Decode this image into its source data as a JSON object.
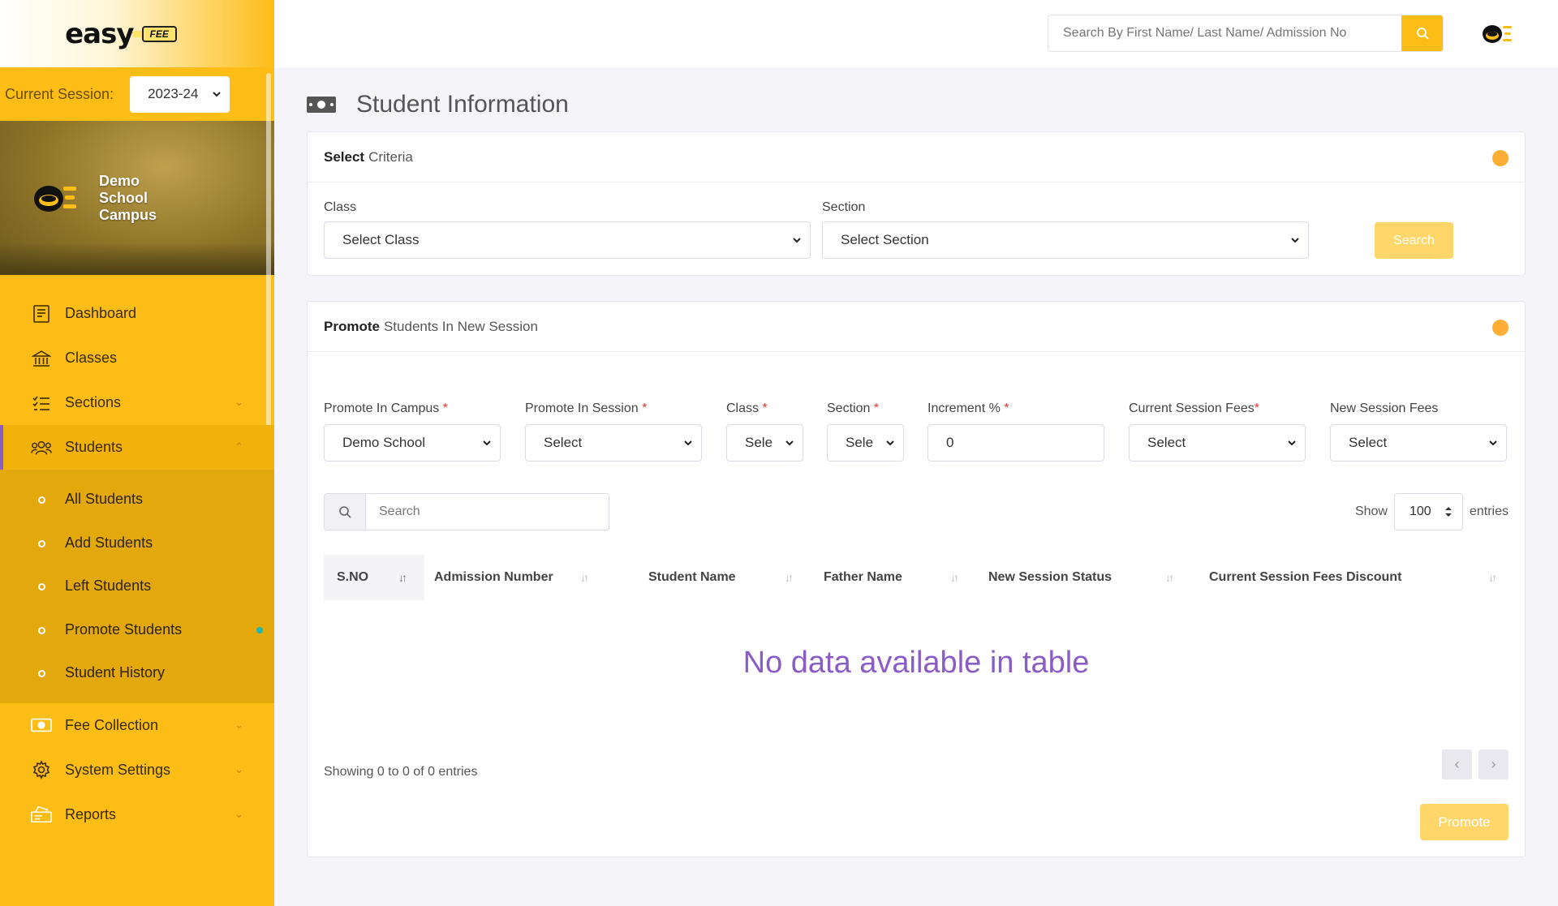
{
  "brand": {
    "word": "easy",
    "badge": "FEE"
  },
  "session": {
    "label": "Current Session:",
    "value": "2023-24"
  },
  "campus": {
    "name": "Demo School Campus"
  },
  "nav": {
    "dashboard": "Dashboard",
    "classes": "Classes",
    "sections": "Sections",
    "students": "Students",
    "students_sub": [
      "All Students",
      "Add Students",
      "Left Students",
      "Promote Students",
      "Student History"
    ],
    "fee_collection": "Fee Collection",
    "system_settings": "System Settings",
    "reports": "Reports"
  },
  "topbar": {
    "search_placeholder": "Search By First Name/ Last Name/ Admission No"
  },
  "page": {
    "title": "Student Information"
  },
  "criteria": {
    "title_bold": "Select",
    "title_rest": "Criteria",
    "class_label": "Class",
    "class_value": "Select Class",
    "section_label": "Section",
    "section_value": "Select Section",
    "search_button": "Search"
  },
  "promote": {
    "title_bold": "Promote",
    "title_rest": "Students In New Session",
    "fields": {
      "campus_label": "Promote In Campus",
      "campus_value": "Demo School",
      "session_label": "Promote In Session",
      "session_value": "Select",
      "class_label": "Class",
      "class_value": "Sele",
      "section_label": "Section",
      "section_value": "Sele",
      "increment_label": "Increment %",
      "increment_value": "0",
      "current_fees_label": "Current Session Fees",
      "current_fees_value": "Select",
      "new_fees_label": "New Session Fees",
      "new_fees_value": "Select",
      "required_mark": "*"
    },
    "table": {
      "search_placeholder": "Search",
      "show_label": "Show",
      "show_value": "100",
      "entries_label": "entries",
      "columns": [
        "S.NO",
        "Admission Number",
        "Student Name",
        "Father Name",
        "New Session Status",
        "Current Session Fees Discount"
      ],
      "empty_message": "No data available in table",
      "info": "Showing 0 to 0 of 0 entries"
    },
    "promote_button": "Promote"
  },
  "colors": {
    "sidebar": "#fdbd17",
    "accent_purple": "#8a5cc5",
    "button_yellow": "#fed669",
    "orb": "#fdae35"
  }
}
